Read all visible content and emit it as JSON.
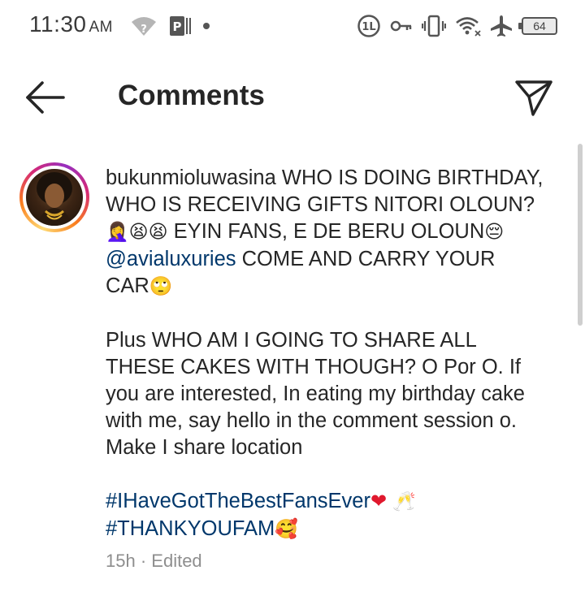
{
  "status_bar": {
    "time": "11:30",
    "ampm": "AM",
    "battery": "64",
    "icons": [
      "wifi-question-icon",
      "parking-app-icon",
      "notification-dot-icon",
      "one-l-icon",
      "key-icon",
      "vibrate-icon",
      "wifi-icon",
      "airplane-icon",
      "battery-icon"
    ]
  },
  "header": {
    "title": "Comments",
    "back_icon": "arrow-left-icon",
    "share_icon": "paper-plane-icon"
  },
  "comment": {
    "username": "bukunmioluwasina",
    "paragraph1": {
      "part1": " WHO IS DOING BIRTHDAY, WHO IS RECEIVING GIFTS NITORI OLOUN?",
      "emoji1": "🤦‍♀️😫😫",
      "part2": " EYIN FANS, E DE BERU OLOUN",
      "emoji2": "😔",
      "mention": "@avialuxuries",
      "part3": " COME AND CARRY YOUR CAR",
      "emoji3": "🙄"
    },
    "paragraph2": "Plus WHO AM I GOING TO SHARE ALL THESE CAKES WITH THOUGH? O Por O. If you are interested, In eating my birthday cake with me, say hello in the comment session o. Make I share location",
    "hashtag1": "#IHaveGotTheBestFansEver",
    "hashtag1_emoji": "❤",
    "hashtag1_emoji2": "🥂",
    "hashtag2": "#THANKYOUFAM",
    "hashtag2_emoji": "🥰",
    "time": "15h",
    "separator": " · ",
    "edited": "Edited"
  },
  "colors": {
    "text": "#262626",
    "link": "#00376b",
    "meta": "#8e8e8e",
    "heart": "#e0182d"
  }
}
